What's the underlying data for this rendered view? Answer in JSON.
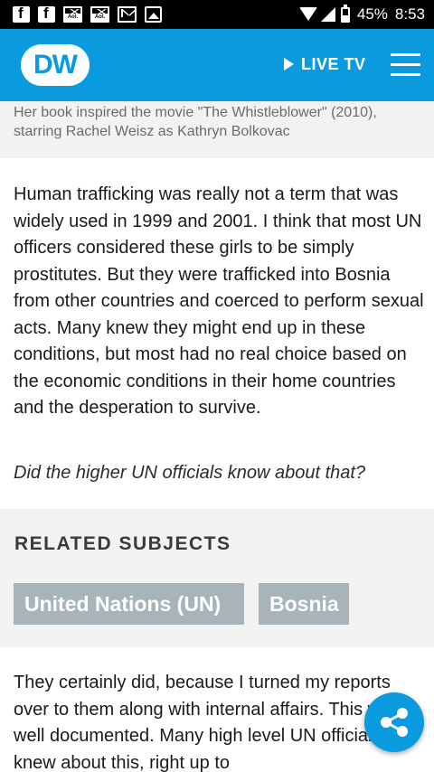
{
  "status_bar": {
    "battery_percent": "45%",
    "time": "8:53",
    "notification_icons": [
      "facebook-icon",
      "facebook-icon",
      "aol-mail-icon",
      "aol-mail-icon",
      "gmail-icon",
      "gallery-icon"
    ],
    "battery_level": 0.45
  },
  "header": {
    "logo_text": "DW",
    "live_tv_label": "LIVE TV",
    "brand_color": "#0a9bde"
  },
  "caption": {
    "text": "Her book inspired the movie \"The Whistleblower\" (2010), starring Rachel Weisz as Kathryn Bolkovac"
  },
  "article": {
    "paragraph_1": "Human trafficking was really not a term that was widely used in 1999 and 2001. I think that most UN officers considered these girls to be simply prostitutes. But they were trafficked into Bosnia from other countries and coerced to perform sexual acts. Many knew they might end up in these conditions, but most had no real choice based on the economic conditions in their home countries and the desperation to survive.",
    "question": "Did the higher UN officials know about that?",
    "paragraph_2": "They certainly did, because I turned my reports over to them along with internal affairs. This was well documented. Many high level UN officials knew about this, right up to"
  },
  "related": {
    "heading": "RELATED SUBJECTS",
    "tags": [
      "United Nations (UN)",
      "Bosnia"
    ]
  },
  "fab": {
    "icon": "share-icon"
  }
}
